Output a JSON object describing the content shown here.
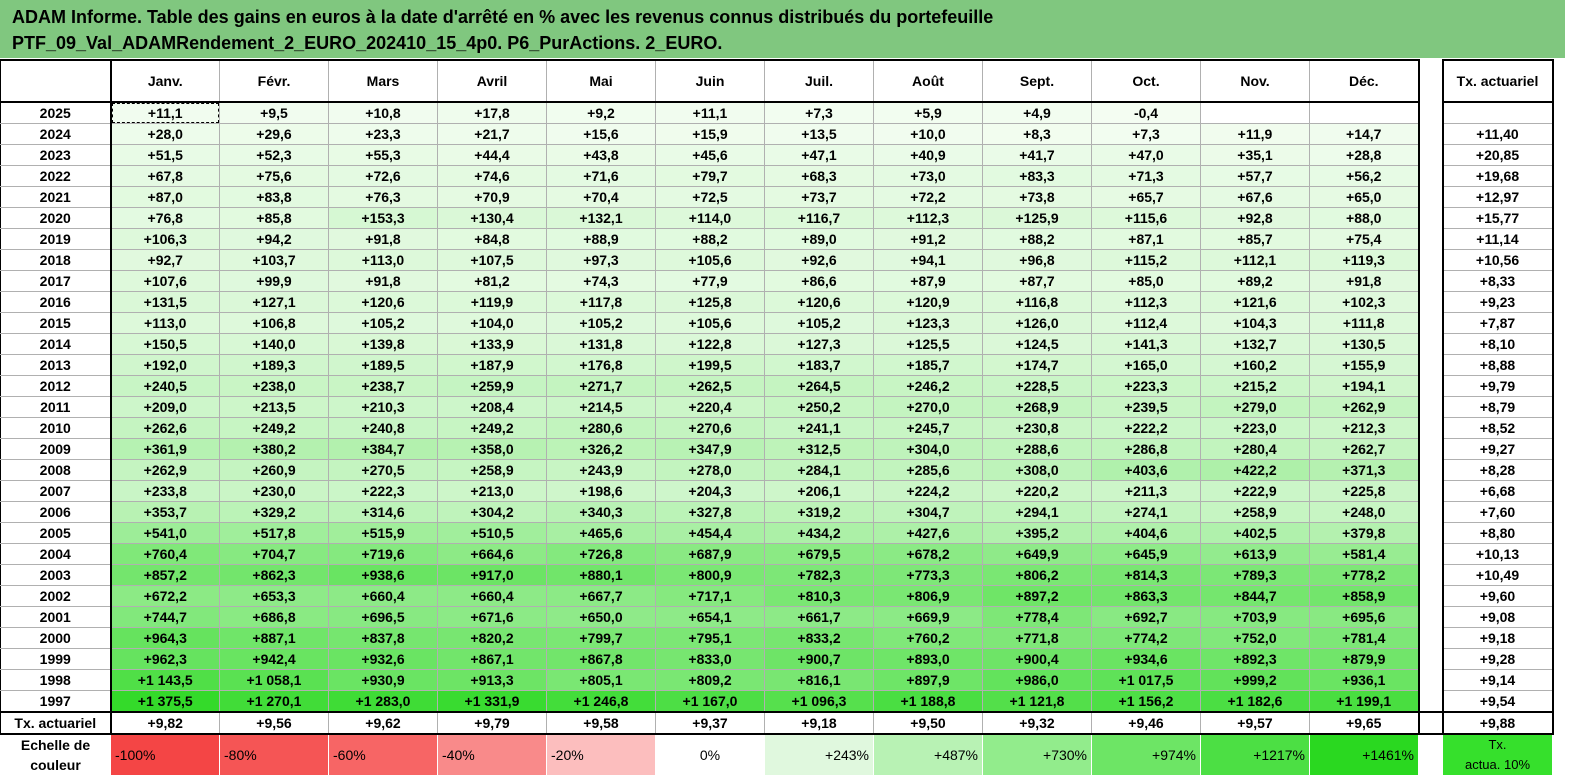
{
  "title": {
    "line1": "ADAM Informe. Table des gains en euros à la date d'arrêté en % avec les revenus connus distribués du portefeuille",
    "line2": "PTF_09_Val_ADAMRendement_2_EURO_202410_15_4p0. P6_PurActions. 2_EURO."
  },
  "months": [
    "Janv.",
    "Févr.",
    "Mars",
    "Avril",
    "Mai",
    "Juin",
    "Juil.",
    "Août",
    "Sept.",
    "Oct.",
    "Nov.",
    "Déc."
  ],
  "tx_header": "Tx. actuariel",
  "rows": [
    {
      "year": "2025",
      "v": [
        "+11,1",
        "+9,5",
        "+10,8",
        "+17,8",
        "+9,2",
        "+11,1",
        "+7,3",
        "+5,9",
        "+4,9",
        "-0,4",
        "",
        ""
      ],
      "tx": ""
    },
    {
      "year": "2024",
      "v": [
        "+28,0",
        "+29,6",
        "+23,3",
        "+21,7",
        "+15,6",
        "+15,9",
        "+13,5",
        "+10,0",
        "+8,3",
        "+7,3",
        "+11,9",
        "+14,7"
      ],
      "tx": "+11,40"
    },
    {
      "year": "2023",
      "v": [
        "+51,5",
        "+52,3",
        "+55,3",
        "+44,4",
        "+43,8",
        "+45,6",
        "+47,1",
        "+40,9",
        "+41,7",
        "+47,0",
        "+35,1",
        "+28,8"
      ],
      "tx": "+20,85"
    },
    {
      "year": "2022",
      "v": [
        "+67,8",
        "+75,6",
        "+72,6",
        "+74,6",
        "+71,6",
        "+79,7",
        "+68,3",
        "+73,0",
        "+83,3",
        "+71,3",
        "+57,7",
        "+56,2"
      ],
      "tx": "+19,68"
    },
    {
      "year": "2021",
      "v": [
        "+87,0",
        "+83,8",
        "+76,3",
        "+70,9",
        "+70,4",
        "+72,5",
        "+73,7",
        "+72,2",
        "+73,8",
        "+65,7",
        "+67,6",
        "+65,0"
      ],
      "tx": "+12,97"
    },
    {
      "year": "2020",
      "v": [
        "+76,8",
        "+85,8",
        "+153,3",
        "+130,4",
        "+132,1",
        "+114,0",
        "+116,7",
        "+112,3",
        "+125,9",
        "+115,6",
        "+92,8",
        "+88,0"
      ],
      "tx": "+15,77"
    },
    {
      "year": "2019",
      "v": [
        "+106,3",
        "+94,2",
        "+91,8",
        "+84,8",
        "+88,9",
        "+88,2",
        "+89,0",
        "+91,2",
        "+88,2",
        "+87,1",
        "+85,7",
        "+75,4"
      ],
      "tx": "+11,14"
    },
    {
      "year": "2018",
      "v": [
        "+92,7",
        "+103,7",
        "+113,0",
        "+107,5",
        "+97,3",
        "+105,6",
        "+92,6",
        "+94,1",
        "+96,8",
        "+115,2",
        "+112,1",
        "+119,3"
      ],
      "tx": "+10,56"
    },
    {
      "year": "2017",
      "v": [
        "+107,6",
        "+99,9",
        "+91,8",
        "+81,2",
        "+74,3",
        "+77,9",
        "+86,6",
        "+87,9",
        "+87,7",
        "+85,0",
        "+89,2",
        "+91,8"
      ],
      "tx": "+8,33"
    },
    {
      "year": "2016",
      "v": [
        "+131,5",
        "+127,1",
        "+120,6",
        "+119,9",
        "+117,8",
        "+125,8",
        "+120,6",
        "+120,9",
        "+116,8",
        "+112,3",
        "+121,6",
        "+102,3"
      ],
      "tx": "+9,23"
    },
    {
      "year": "2015",
      "v": [
        "+113,0",
        "+106,8",
        "+105,2",
        "+104,0",
        "+105,2",
        "+105,6",
        "+105,2",
        "+123,3",
        "+126,0",
        "+112,4",
        "+104,3",
        "+111,8"
      ],
      "tx": "+7,87"
    },
    {
      "year": "2014",
      "v": [
        "+150,5",
        "+140,0",
        "+139,8",
        "+133,9",
        "+131,8",
        "+122,8",
        "+127,3",
        "+125,5",
        "+124,5",
        "+141,3",
        "+132,7",
        "+130,5"
      ],
      "tx": "+8,10"
    },
    {
      "year": "2013",
      "v": [
        "+192,0",
        "+189,3",
        "+189,5",
        "+187,9",
        "+176,8",
        "+199,5",
        "+183,7",
        "+185,7",
        "+174,7",
        "+165,0",
        "+160,2",
        "+155,9"
      ],
      "tx": "+8,88"
    },
    {
      "year": "2012",
      "v": [
        "+240,5",
        "+238,0",
        "+238,7",
        "+259,9",
        "+271,7",
        "+262,5",
        "+264,5",
        "+246,2",
        "+228,5",
        "+223,3",
        "+215,2",
        "+194,1"
      ],
      "tx": "+9,79"
    },
    {
      "year": "2011",
      "v": [
        "+209,0",
        "+213,5",
        "+210,3",
        "+208,4",
        "+214,5",
        "+220,4",
        "+250,2",
        "+270,0",
        "+268,9",
        "+239,5",
        "+279,0",
        "+262,9"
      ],
      "tx": "+8,79"
    },
    {
      "year": "2010",
      "v": [
        "+262,6",
        "+249,2",
        "+240,8",
        "+249,2",
        "+280,6",
        "+270,6",
        "+241,1",
        "+245,7",
        "+230,8",
        "+222,2",
        "+223,0",
        "+212,3"
      ],
      "tx": "+8,52"
    },
    {
      "year": "2009",
      "v": [
        "+361,9",
        "+380,2",
        "+384,7",
        "+358,0",
        "+326,2",
        "+347,9",
        "+312,5",
        "+304,0",
        "+288,6",
        "+286,8",
        "+280,4",
        "+262,7"
      ],
      "tx": "+9,27"
    },
    {
      "year": "2008",
      "v": [
        "+262,9",
        "+260,9",
        "+270,5",
        "+258,9",
        "+243,9",
        "+278,0",
        "+284,1",
        "+285,6",
        "+308,0",
        "+403,6",
        "+422,2",
        "+371,3"
      ],
      "tx": "+8,28"
    },
    {
      "year": "2007",
      "v": [
        "+233,8",
        "+230,0",
        "+222,3",
        "+213,0",
        "+198,6",
        "+204,3",
        "+206,1",
        "+224,2",
        "+220,2",
        "+211,3",
        "+222,9",
        "+225,8"
      ],
      "tx": "+6,68"
    },
    {
      "year": "2006",
      "v": [
        "+353,7",
        "+329,2",
        "+314,6",
        "+304,2",
        "+340,3",
        "+327,8",
        "+319,2",
        "+304,7",
        "+294,1",
        "+274,1",
        "+258,9",
        "+248,0"
      ],
      "tx": "+7,60"
    },
    {
      "year": "2005",
      "v": [
        "+541,0",
        "+517,8",
        "+515,9",
        "+510,5",
        "+465,6",
        "+454,4",
        "+434,2",
        "+427,6",
        "+395,2",
        "+404,6",
        "+402,5",
        "+379,8"
      ],
      "tx": "+8,80"
    },
    {
      "year": "2004",
      "v": [
        "+760,4",
        "+704,7",
        "+719,6",
        "+664,6",
        "+726,8",
        "+687,9",
        "+679,5",
        "+678,2",
        "+649,9",
        "+645,9",
        "+613,9",
        "+581,4"
      ],
      "tx": "+10,13"
    },
    {
      "year": "2003",
      "v": [
        "+857,2",
        "+862,3",
        "+938,6",
        "+917,0",
        "+880,1",
        "+800,9",
        "+782,3",
        "+773,3",
        "+806,2",
        "+814,3",
        "+789,3",
        "+778,2"
      ],
      "tx": "+10,49"
    },
    {
      "year": "2002",
      "v": [
        "+672,2",
        "+653,3",
        "+660,4",
        "+660,4",
        "+667,7",
        "+717,1",
        "+810,3",
        "+806,9",
        "+897,2",
        "+863,3",
        "+844,7",
        "+858,9"
      ],
      "tx": "+9,60"
    },
    {
      "year": "2001",
      "v": [
        "+744,7",
        "+686,8",
        "+696,5",
        "+671,6",
        "+650,0",
        "+654,1",
        "+661,7",
        "+669,9",
        "+778,4",
        "+692,7",
        "+703,9",
        "+695,6"
      ],
      "tx": "+9,08"
    },
    {
      "year": "2000",
      "v": [
        "+964,3",
        "+887,1",
        "+837,8",
        "+820,2",
        "+799,7",
        "+795,1",
        "+833,2",
        "+760,2",
        "+771,8",
        "+774,2",
        "+752,0",
        "+781,4"
      ],
      "tx": "+9,18"
    },
    {
      "year": "1999",
      "v": [
        "+962,3",
        "+942,4",
        "+932,6",
        "+867,1",
        "+867,8",
        "+833,0",
        "+900,7",
        "+893,0",
        "+900,4",
        "+934,6",
        "+892,3",
        "+879,9"
      ],
      "tx": "+9,28"
    },
    {
      "year": "1998",
      "v": [
        "+1 143,5",
        "+1 058,1",
        "+930,9",
        "+913,3",
        "+805,1",
        "+809,2",
        "+816,1",
        "+897,9",
        "+986,0",
        "+1 017,5",
        "+999,2",
        "+936,1"
      ],
      "tx": "+9,14"
    },
    {
      "year": "1997",
      "v": [
        "+1 375,5",
        "+1 270,1",
        "+1 283,0",
        "+1 331,9",
        "+1 246,8",
        "+1 167,0",
        "+1 096,3",
        "+1 188,8",
        "+1 121,8",
        "+1 156,2",
        "+1 182,6",
        "+1 199,1"
      ],
      "tx": "+9,54"
    }
  ],
  "tx_row": {
    "label": "Tx. actuariel",
    "v": [
      "+9,82",
      "+9,56",
      "+9,62",
      "+9,79",
      "+9,58",
      "+9,37",
      "+9,18",
      "+9,50",
      "+9,32",
      "+9,46",
      "+9,57",
      "+9,65"
    ],
    "tx": "+9,88"
  },
  "scale": {
    "label_line1": "Echelle de",
    "label_line2": "couleur",
    "items": [
      {
        "label": "-100%",
        "color": "#f44545"
      },
      {
        "label": "-80%",
        "color": "#f55555"
      },
      {
        "label": "-60%",
        "color": "#f76565"
      },
      {
        "label": "-40%",
        "color": "#f98a8a"
      },
      {
        "label": "-20%",
        "color": "#fcbebe"
      },
      {
        "label": "0%",
        "color": "#ffffff"
      },
      {
        "label": "+243%",
        "color": "#e0f8de"
      },
      {
        "label": "+487%",
        "color": "#b8f2b4"
      },
      {
        "label": "+730%",
        "color": "#92ec8c"
      },
      {
        "label": "+974%",
        "color": "#6de565"
      },
      {
        "label": "+1217%",
        "color": "#4cdf44"
      },
      {
        "label": "+1461%",
        "color": "#2ad820"
      }
    ],
    "tx_line1": "Tx.",
    "tx_line2": "actua. 10%",
    "tx_color": "#36e02c"
  }
}
